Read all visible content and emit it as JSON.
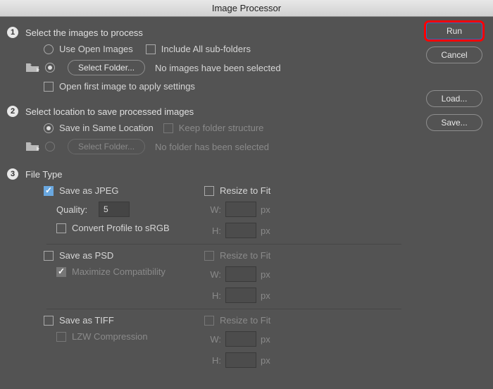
{
  "title": "Image Processor",
  "buttons": {
    "run": "Run",
    "cancel": "Cancel",
    "load": "Load...",
    "save": "Save..."
  },
  "step1": {
    "num": "1",
    "heading": "Select the images to process",
    "use_open": "Use Open Images",
    "include_sub": "Include All sub-folders",
    "select_folder": "Select Folder...",
    "no_images": "No images have been selected",
    "open_first": "Open first image to apply settings"
  },
  "step2": {
    "num": "2",
    "heading": "Select location to save processed images",
    "same_loc": "Save in Same Location",
    "keep_struct": "Keep folder structure",
    "select_folder": "Select Folder...",
    "no_folder": "No folder has been selected"
  },
  "step3": {
    "num": "3",
    "heading": "File Type",
    "jpeg": {
      "label": "Save as JPEG",
      "quality_label": "Quality:",
      "quality_value": "5",
      "convert": "Convert Profile to sRGB",
      "resize": "Resize to Fit",
      "w_label": "W:",
      "h_label": "H:",
      "unit": "px"
    },
    "psd": {
      "label": "Save as PSD",
      "maxcompat": "Maximize Compatibility",
      "resize": "Resize to Fit",
      "w_label": "W:",
      "h_label": "H:",
      "unit": "px"
    },
    "tiff": {
      "label": "Save as TIFF",
      "lzw": "LZW Compression",
      "resize": "Resize to Fit",
      "w_label": "W:",
      "h_label": "H:",
      "unit": "px"
    }
  }
}
